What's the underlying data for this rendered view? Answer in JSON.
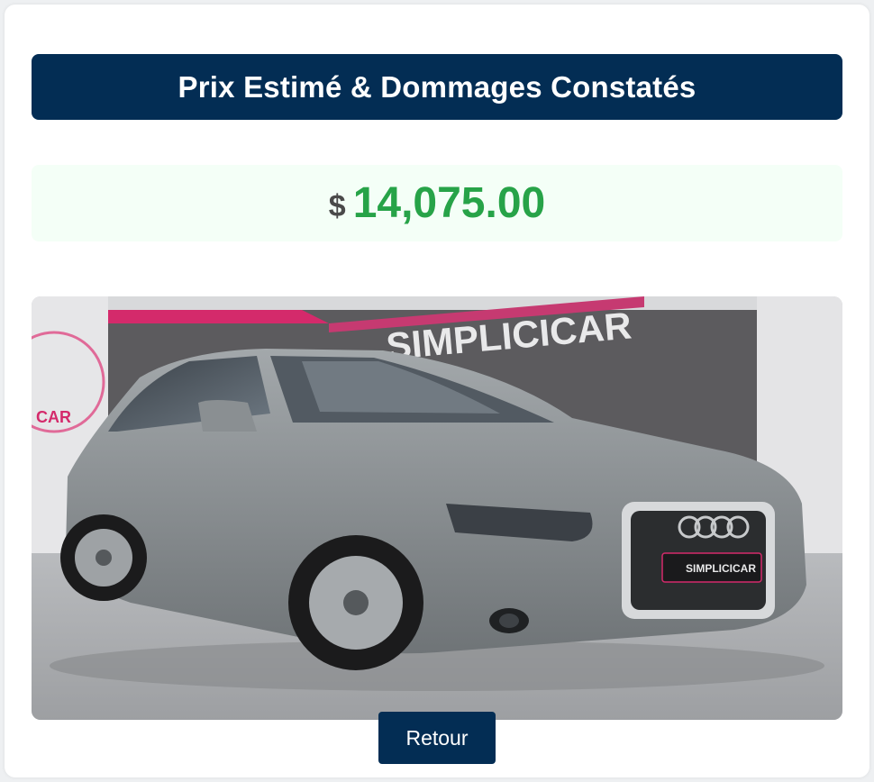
{
  "header": {
    "title": "Prix Estimé & Dommages Constatés"
  },
  "price": {
    "currency_symbol": "$",
    "amount": "14,075.00"
  },
  "photo": {
    "dealer_sign": "SIMPLICICAR",
    "plate_text": "SIMPLICICAR",
    "colors": {
      "car": "#8e9396",
      "wall": "#5c5b5e",
      "brand_pink": "#d42a6b"
    }
  },
  "actions": {
    "back_label": "Retour"
  },
  "colors": {
    "primary": "#032d54",
    "price_green": "#27a348",
    "price_bg": "#f4fff7"
  }
}
